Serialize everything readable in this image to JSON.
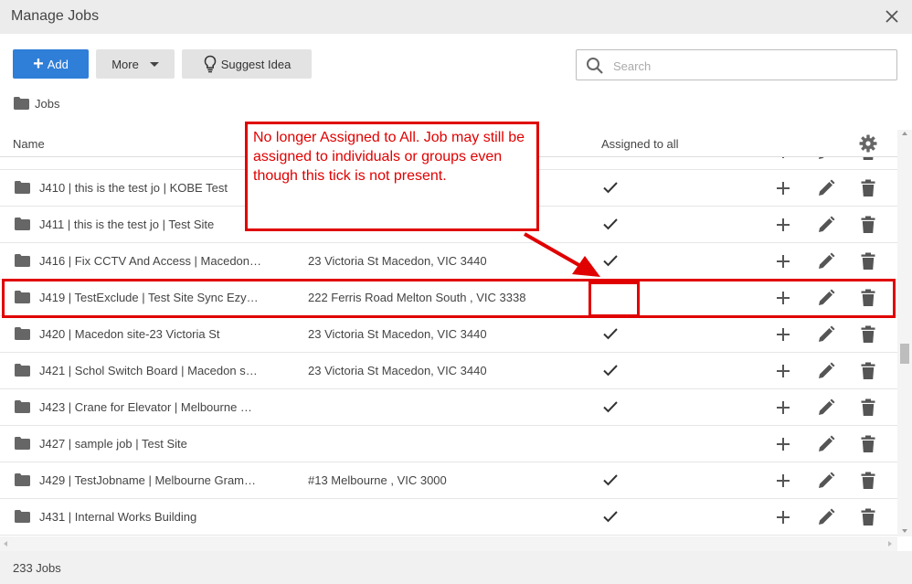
{
  "window": {
    "title": "Manage Jobs"
  },
  "toolbar": {
    "add_label": "Add",
    "more_label": "More",
    "suggest_label": "Suggest Idea"
  },
  "search": {
    "placeholder": "Search",
    "value": ""
  },
  "breadcrumb": {
    "label": "Jobs"
  },
  "table": {
    "headers": {
      "name": "Name",
      "assigned": "Assigned to all"
    },
    "rows": [
      {
        "name": "J410 | this is the test jo | KOBE Test",
        "address": "",
        "assigned": true
      },
      {
        "name": "J411 | this is the test jo | Test Site",
        "address": "",
        "assigned": true
      },
      {
        "name": "J416 | Fix CCTV And Access | Macedon…",
        "address": "23 Victoria St Macedon, VIC 3440",
        "assigned": true
      },
      {
        "name": "J419 | TestExclude | Test Site Sync Ezy…",
        "address": "222 Ferris Road Melton South , VIC 3338",
        "assigned": false
      },
      {
        "name": "J420 | Macedon site-23 Victoria St",
        "address": "23 Victoria St Macedon, VIC 3440",
        "assigned": true
      },
      {
        "name": "J421 | Schol Switch Board | Macedon s…",
        "address": "23 Victoria St Macedon, VIC 3440",
        "assigned": true
      },
      {
        "name": "J423 | Crane for Elevator | Melbourne …",
        "address": "",
        "assigned": true
      },
      {
        "name": "J427 | sample job | Test Site",
        "address": "",
        "assigned": false
      },
      {
        "name": "J429 | TestJobname | Melbourne Gram…",
        "address": "#13 Melbourne , VIC 3000",
        "assigned": true
      },
      {
        "name": "J431 | Internal Works Building",
        "address": "",
        "assigned": true
      }
    ]
  },
  "footer": {
    "count": "233 Jobs"
  },
  "annotation": {
    "text": "No longer Assigned to All. Job may still be assigned to individuals or groups even though this tick is not present.",
    "color": "#e00000"
  },
  "colors": {
    "accent": "#2f7ed8",
    "icon": "#555555"
  }
}
